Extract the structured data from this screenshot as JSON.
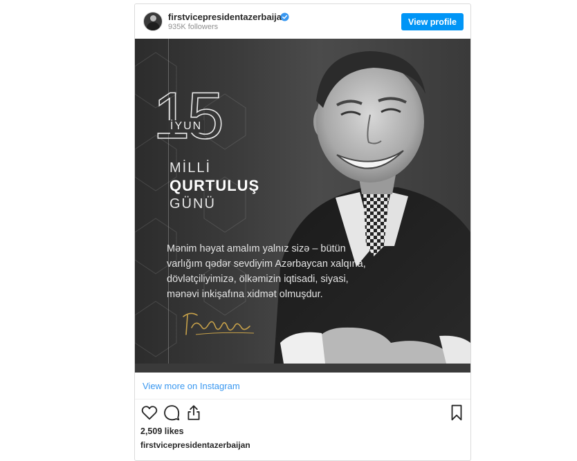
{
  "post_header": {
    "username": "firstvicepresidentazerbaijan",
    "followers": "935K followers",
    "view_profile_label": "View profile"
  },
  "post_image": {
    "day_number": "15",
    "month": "İYUN",
    "title_line1": "MİLLİ",
    "title_line2": "QURTULUŞ",
    "title_line3": "GÜNÜ",
    "quote_lines": [
      "Mənim həyat amalım yalnız sizə – bütün",
      "varlığım qədər sevdiyim Azərbaycan xalqına,",
      "dövlətçiliyimizə, ölkəmizin iqtisadi, siyasi,",
      "mənəvi inkişafına xidmət olmuşdur."
    ]
  },
  "footer": {
    "view_more_label": "View more on Instagram",
    "likes": "2,509 likes",
    "caption_username": "firstvicepresidentazerbaijan"
  },
  "icons": {
    "verified": "verified-badge-icon",
    "like": "heart-icon",
    "comment": "comment-icon",
    "share": "share-icon",
    "save": "bookmark-icon"
  },
  "colors": {
    "accent": "#0095f6",
    "link": "#3897f0",
    "border": "#dbdbdb",
    "text": "#262626",
    "muted": "#8e8e8e"
  }
}
